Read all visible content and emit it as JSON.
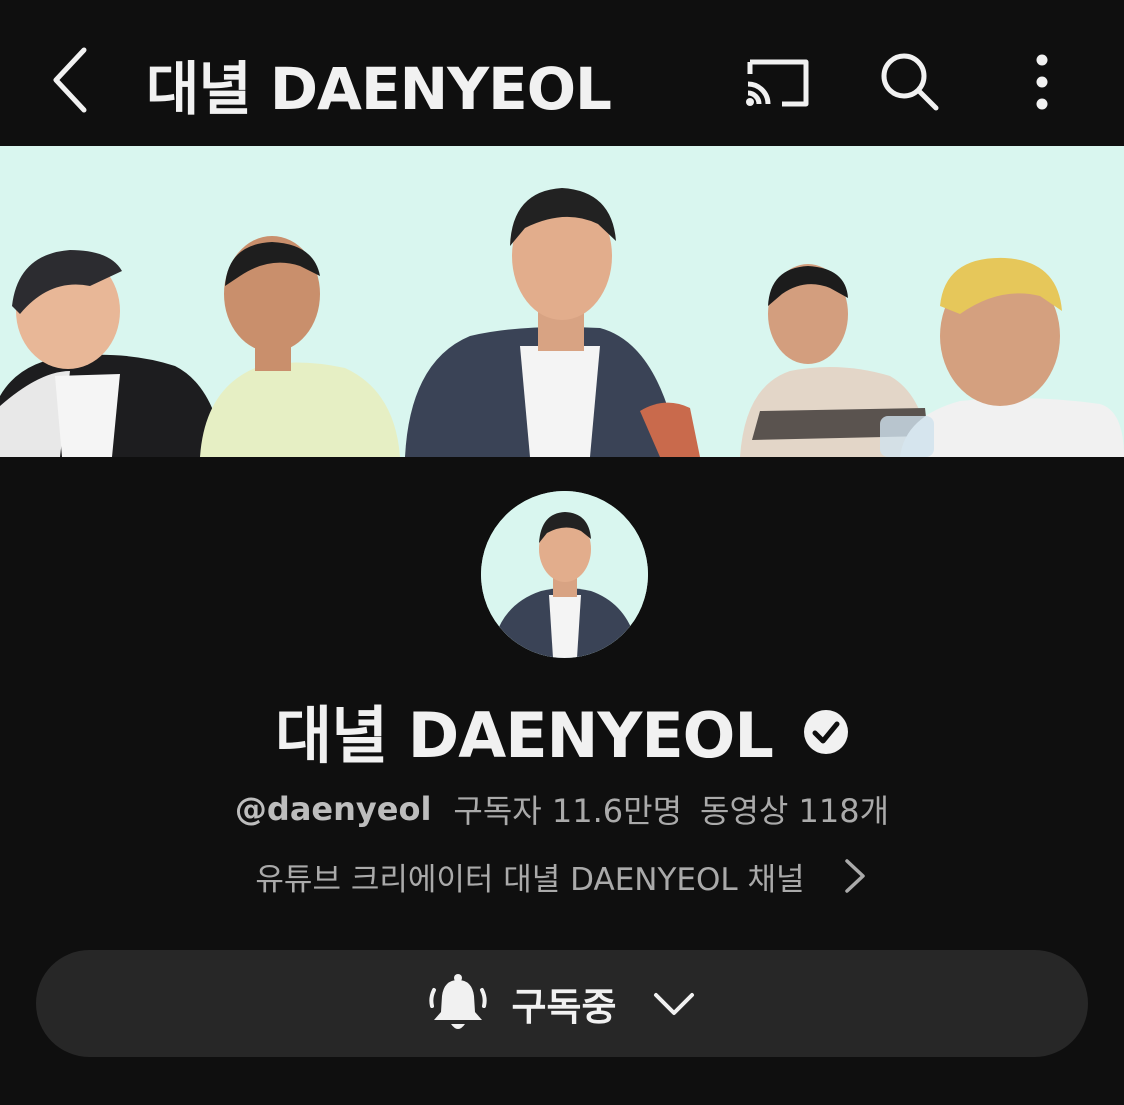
{
  "app_bar": {
    "title": "대녈 DAENYEOL",
    "icons": [
      "chevron-left-icon",
      "cast-icon",
      "search-icon",
      "more-vertical-icon"
    ]
  },
  "channel": {
    "name": "대녈 DAENYEOL",
    "verified": true,
    "handle": "@daenyeol",
    "subscribers": "구독자 11.6만명",
    "videos": "동영상 118개",
    "description": "유튜브 크리에이터 대녈 DAENYEOL 채널"
  },
  "subscribe": {
    "label": "구독중",
    "icons": [
      "bell-icon",
      "chevron-down-icon"
    ]
  },
  "colors": {
    "background": "#0f0f0f",
    "banner": "#d9f6ef",
    "pill": "#272727",
    "text_primary": "#f1f1f1",
    "text_secondary": "#aaaaaa"
  }
}
